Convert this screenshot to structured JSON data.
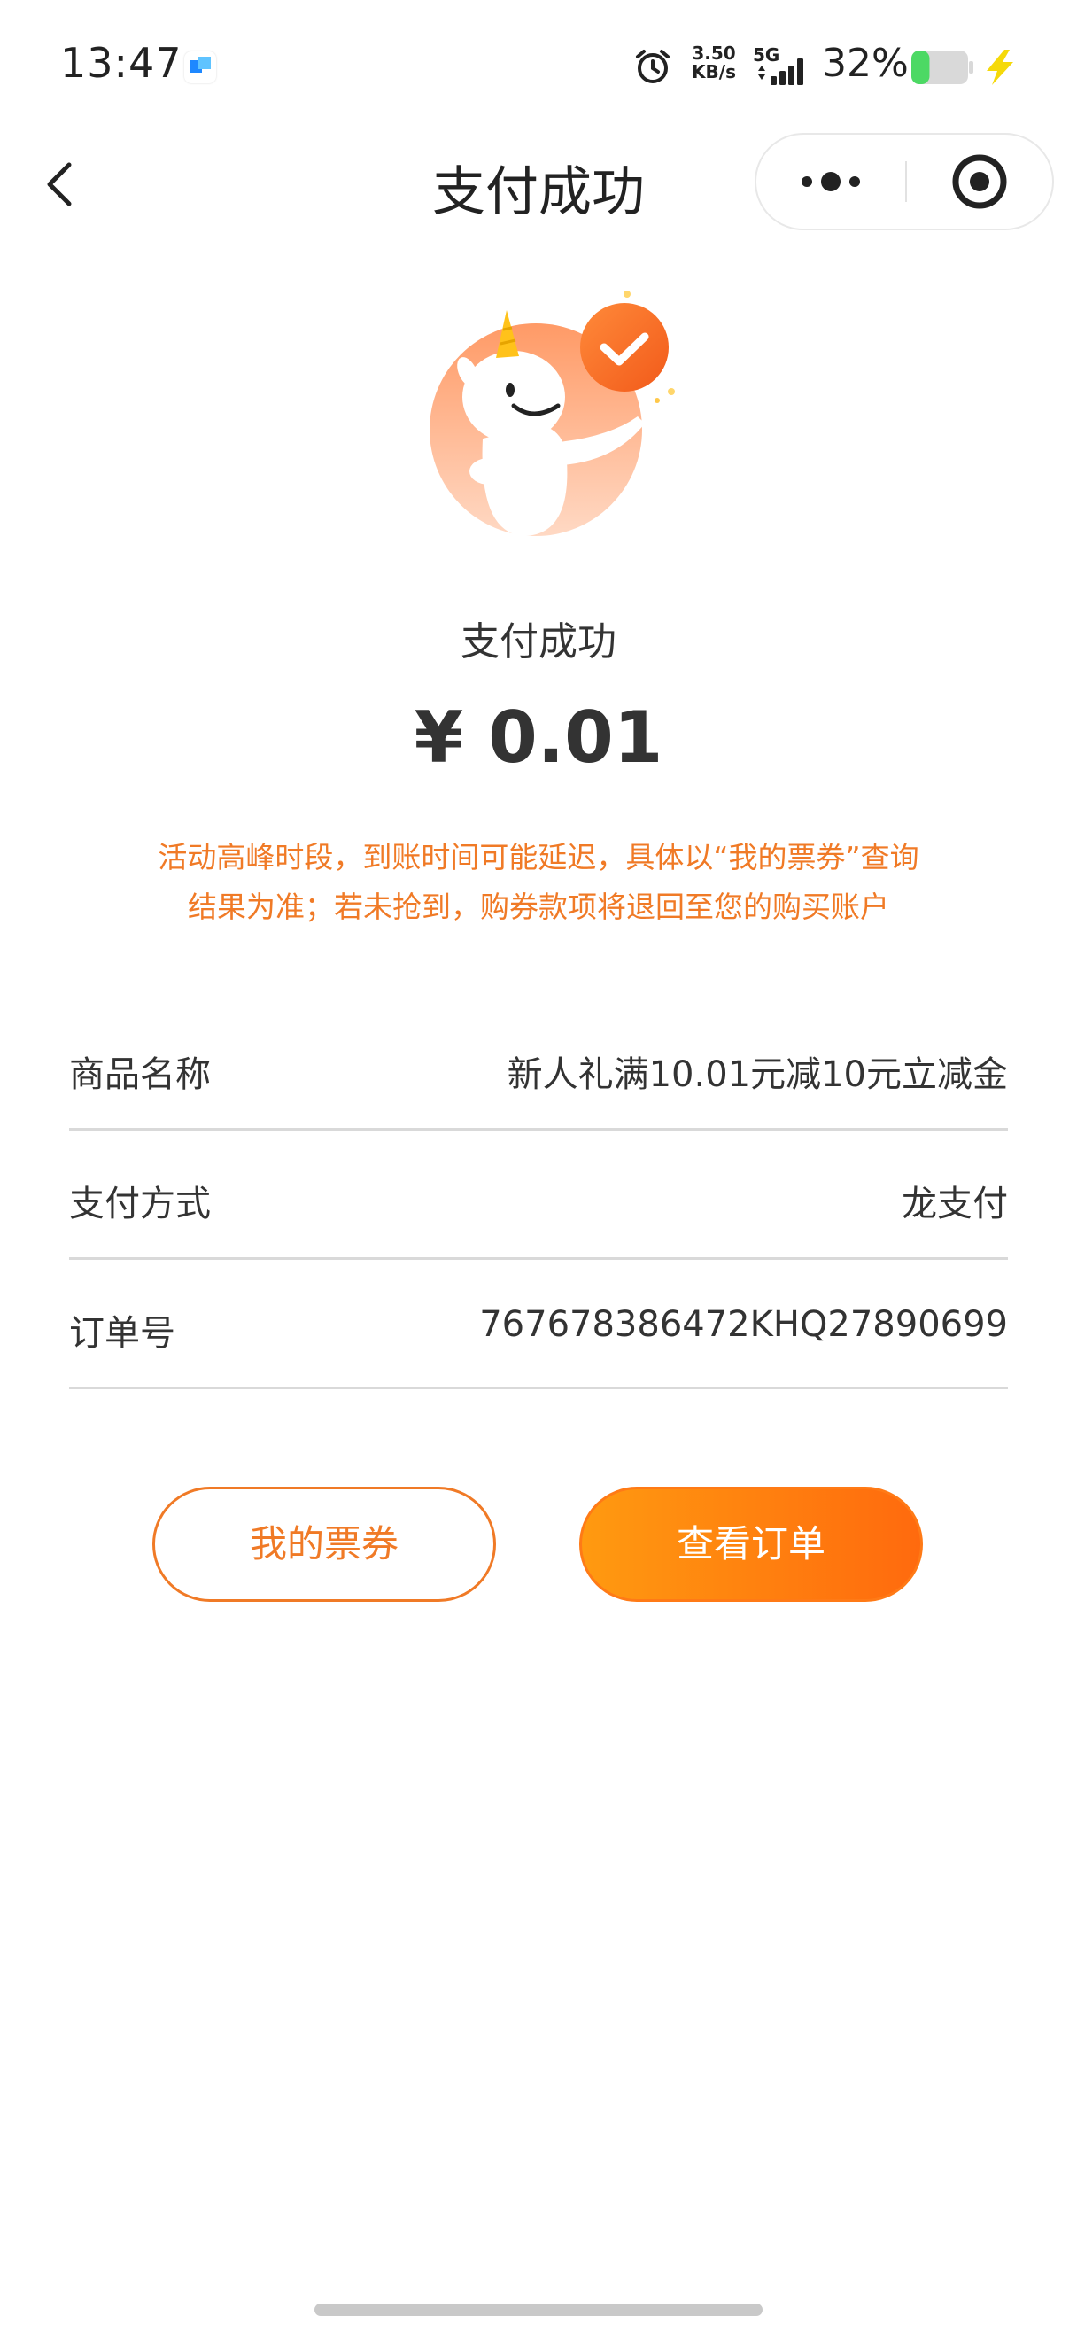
{
  "status_bar": {
    "time": "13:47",
    "net_speed_value": "3.50",
    "net_speed_unit": "KB/s",
    "network_type": "5G",
    "battery_percent": "32%",
    "battery_level": 0.32,
    "icons": [
      "app-notification-icon",
      "alarm-icon",
      "signal-icon",
      "battery-icon",
      "charging-icon"
    ]
  },
  "nav": {
    "title": "支付成功",
    "back_icon": "chevron-left-icon",
    "more_icon": "more-dots-icon",
    "close_icon": "target-circle-icon"
  },
  "result": {
    "title": "支付成功",
    "amount": "¥ 0.01",
    "notice_line1": "活动高峰时段，到账时间可能延迟，具体以“我的票券”查询",
    "notice_line2": "结果为准；若未抢到，购券款项将退回至您的购买账户",
    "mascot_icon": "unicorn-success-mascot",
    "badge_icon": "check-badge-icon"
  },
  "info": [
    {
      "label": "商品名称",
      "value": "新人礼满10.01元减10元立减金"
    },
    {
      "label": "支付方式",
      "value": "龙支付"
    },
    {
      "label": "订单号",
      "value": "767678386472KHQ27890699"
    }
  ],
  "buttons": {
    "my_tickets": "我的票券",
    "view_order": "查看订单"
  },
  "colors": {
    "accent": "#f07a26",
    "gradient_start": "#ff9a10",
    "gradient_end": "#ff6a0e",
    "divider": "#d9d9d9",
    "text": "#333333"
  }
}
